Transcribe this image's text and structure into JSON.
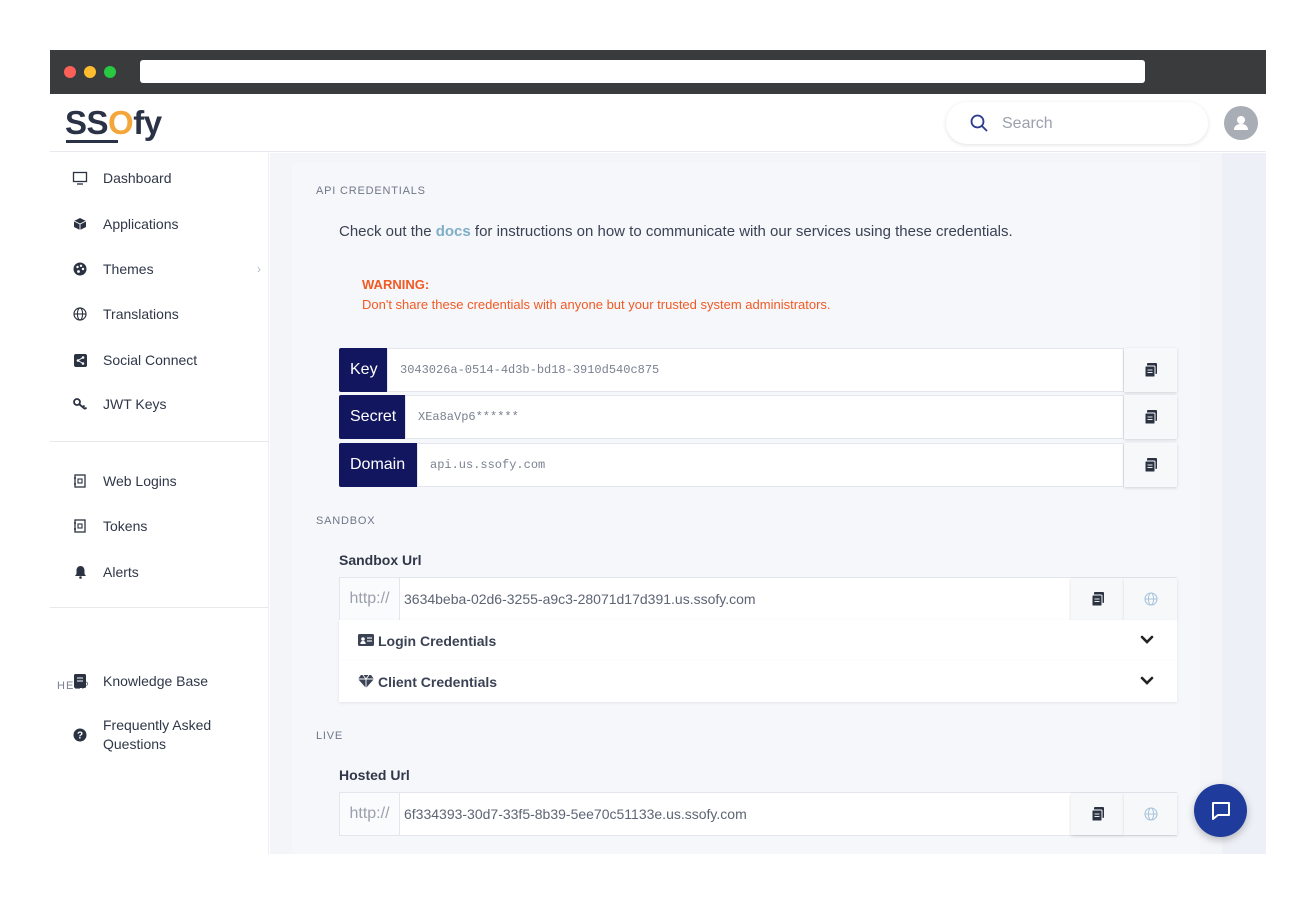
{
  "header": {
    "logo_text_a": "SS",
    "logo_text_b": "O",
    "logo_text_c": "fy",
    "search_placeholder": "Search"
  },
  "sidebar": {
    "items": [
      {
        "label": "Dashboard",
        "icon": "monitor-icon"
      },
      {
        "label": "Applications",
        "icon": "cube-icon"
      },
      {
        "label": "Themes",
        "icon": "palette-icon"
      },
      {
        "label": "Translations",
        "icon": "globe-icon"
      },
      {
        "label": "Social Connect",
        "icon": "share-icon"
      },
      {
        "label": "JWT Keys",
        "icon": "key-icon"
      }
    ],
    "items2": [
      {
        "label": "Web Logins",
        "icon": "book-icon"
      },
      {
        "label": "Tokens",
        "icon": "book-icon"
      },
      {
        "label": "Alerts",
        "icon": "bell-icon"
      }
    ],
    "help_title": "HELP",
    "help_items": [
      {
        "label": "Knowledge Base",
        "icon": "book-icon"
      },
      {
        "label": "Frequently Asked\nQuestions",
        "icon": "question-circle-icon"
      }
    ]
  },
  "api": {
    "section_title": "API CREDENTIALS",
    "intro_pre": "Check out the ",
    "intro_link": "docs",
    "intro_post": " for instructions on how to communicate with our services using these credentials.",
    "warning_title": "WARNING:",
    "warning_text": "Don't share these credentials with anyone but your trusted system administrators.",
    "credentials": [
      {
        "label": "Key",
        "value": "3043026a-0514-4d3b-bd18-3910d540c875"
      },
      {
        "label": "Secret",
        "value": "XEa8aVp6******"
      },
      {
        "label": "Domain",
        "value": "api.us.ssofy.com"
      }
    ]
  },
  "sandbox": {
    "section_title": "SANDBOX",
    "url_label": "Sandbox Url",
    "prefix": "http://",
    "url": "3634beba-02d6-3255-a9c3-28071d17d391.us.ssofy.com",
    "accordions": [
      {
        "label": "Login Credentials",
        "icon": "id-card-icon"
      },
      {
        "label": "Client Credentials",
        "icon": "diamond-icon"
      }
    ]
  },
  "live": {
    "section_title": "LIVE",
    "url_label": "Hosted Url",
    "prefix": "http://",
    "url": "6f334393-30d7-33f5-8b39-5ee70c51133e.us.ssofy.com"
  },
  "colors": {
    "brand_navy": "#12165e",
    "brand_orange": "#f3a73a",
    "warning": "#f15a24",
    "link": "#7faec8",
    "fab": "#1f3c9c"
  }
}
